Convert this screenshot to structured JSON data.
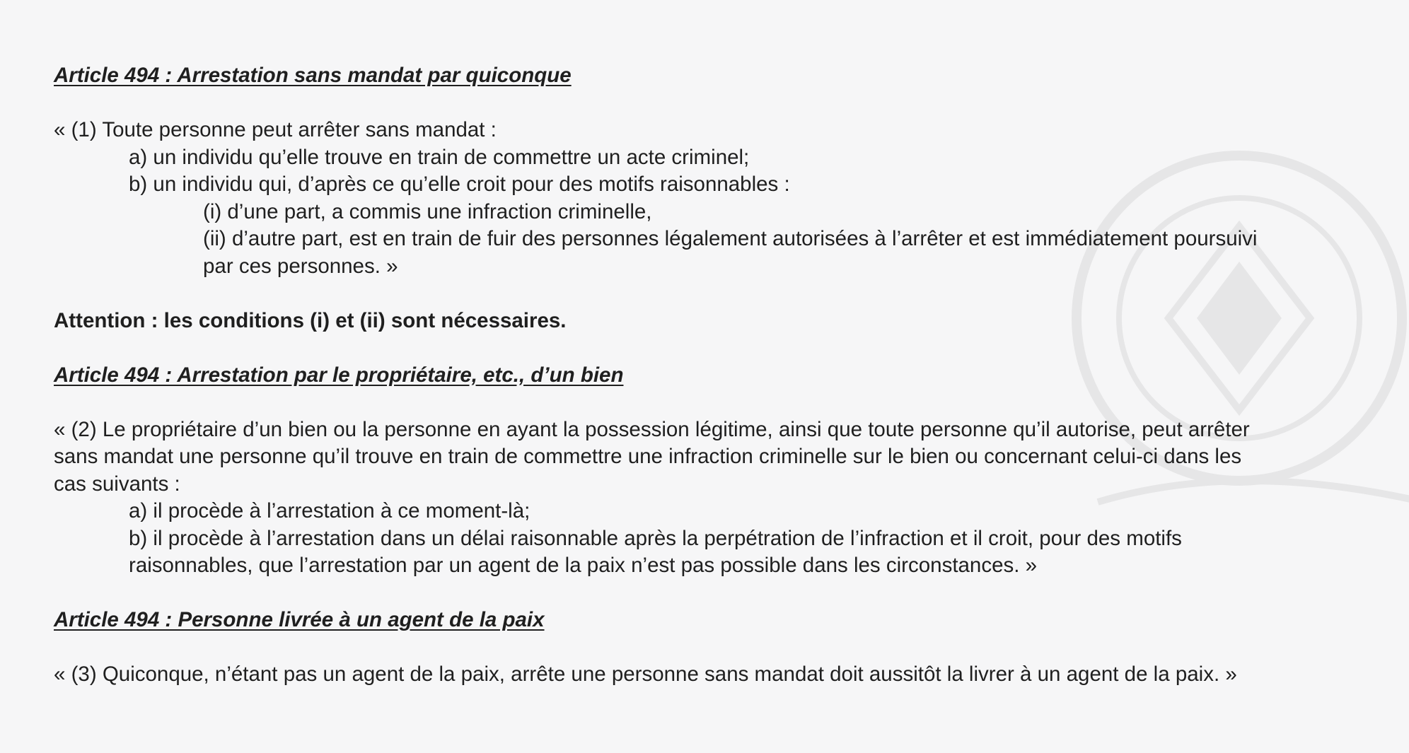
{
  "sections": [
    {
      "heading": "Article 494 : Arrestation sans mandat par quiconque",
      "intro": "« (1) Toute personne peut arrêter sans mandat :",
      "item_a": "a) un individu qu’elle trouve en train de commettre un acte criminel;",
      "item_b": "b) un individu qui, d’après ce qu’elle croit pour des motifs raisonnables :",
      "sub_i": "(i) d’une part, a commis une infraction criminelle,",
      "sub_ii_line1": "(ii) d’autre part, est en train de fuir des personnes légalement autorisées à l’arrêter et est immédiatement poursuivi",
      "sub_ii_line2": "par ces personnes. »"
    },
    {
      "heading": "Article 494 : Arrestation par le propriétaire, etc., d’un bien",
      "intro_line1": "« (2) Le propriétaire d’un bien ou la personne en ayant la possession légitime, ainsi que toute personne qu’il autorise, peut arrêter",
      "intro_line2": "sans mandat une personne qu’il trouve en train de commettre une infraction criminelle sur le bien ou concernant celui-ci dans les",
      "intro_line3": "cas suivants :",
      "item_a": "a) il procède à l’arrestation à ce moment-là;",
      "item_b_line1": "b) il procède à l’arrestation dans un délai raisonnable après la perpétration de l’infraction et il croit, pour des motifs",
      "item_b_line2": "raisonnables, que l’arrestation par un agent de la paix n’est pas possible dans les circonstances. »"
    },
    {
      "heading": "Article 494 : Personne livrée à un agent de la paix",
      "text": "« (3) Quiconque, n’étant pas un agent de la paix, arrête une personne sans mandat doit aussitôt la livrer à un agent de la paix. »"
    }
  ],
  "attention": "Attention : les conditions (i) et (ii) sont nécessaires.",
  "watermark_icon": "security-emblem-icon"
}
